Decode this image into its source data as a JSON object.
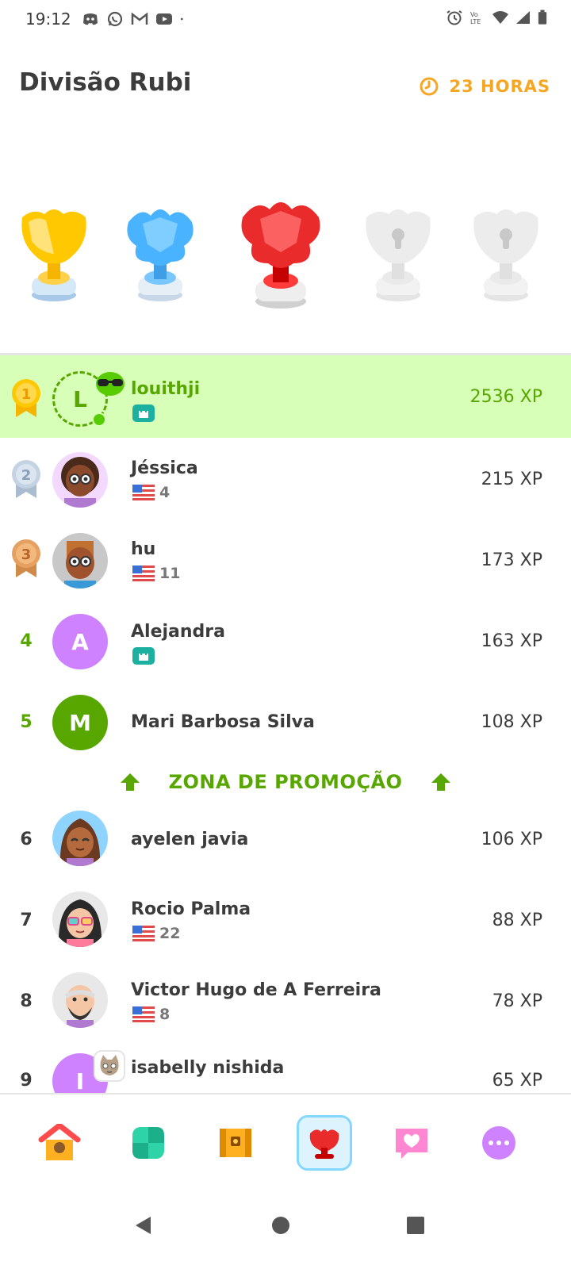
{
  "status_bar": {
    "time": "19:12",
    "left_icons": [
      "discord-icon",
      "whatsapp-icon",
      "gmail-icon",
      "youtube-icon",
      "dot-icon"
    ],
    "right_icons": [
      "alarm-icon",
      "volte-icon",
      "wifi-icon",
      "signal-icon",
      "battery-icon"
    ]
  },
  "header": {
    "title": "Divisão Rubi",
    "timer_label": "23 HORAS",
    "accent": "#f5a623"
  },
  "trophies": [
    "gold-trophy",
    "sapphire-trophy",
    "ruby-trophy",
    "locked-trophy",
    "locked-trophy"
  ],
  "leaderboard": {
    "rows": [
      {
        "rank": "1",
        "name": "louithji",
        "xp": "2536 XP",
        "sub": "",
        "avatar_letter": "L",
        "highlight": true
      },
      {
        "rank": "2",
        "name": "Jéssica",
        "xp": "215 XP",
        "sub": "4"
      },
      {
        "rank": "3",
        "name": "hu",
        "xp": "173 XP",
        "sub": "11"
      },
      {
        "rank": "4",
        "name": "Alejandra",
        "xp": "163 XP",
        "sub": "",
        "avatar_letter": "A"
      },
      {
        "rank": "5",
        "name": "Mari Barbosa Silva",
        "xp": "108 XP",
        "sub": "",
        "avatar_letter": "M"
      },
      {
        "rank": "6",
        "name": "ayelen javia",
        "xp": "106 XP",
        "sub": ""
      },
      {
        "rank": "7",
        "name": "Rocio Palma",
        "xp": "88 XP",
        "sub": "22"
      },
      {
        "rank": "8",
        "name": "Victor Hugo de A Ferreira",
        "xp": "78 XP",
        "sub": "8"
      },
      {
        "rank": "9",
        "name": "isabelly nishida",
        "xp": "65 XP",
        "sub": "",
        "avatar_letter": "I"
      }
    ],
    "promotion_label": "ZONA DE PROMOÇÃO",
    "promo_color": "#58a700",
    "highlight_color": "#d7ffb8"
  },
  "bottom_nav": {
    "items": [
      "home-icon",
      "practice-icon",
      "chest-icon",
      "league-icon",
      "heart-icon",
      "more-icon"
    ],
    "active": "league-icon"
  }
}
